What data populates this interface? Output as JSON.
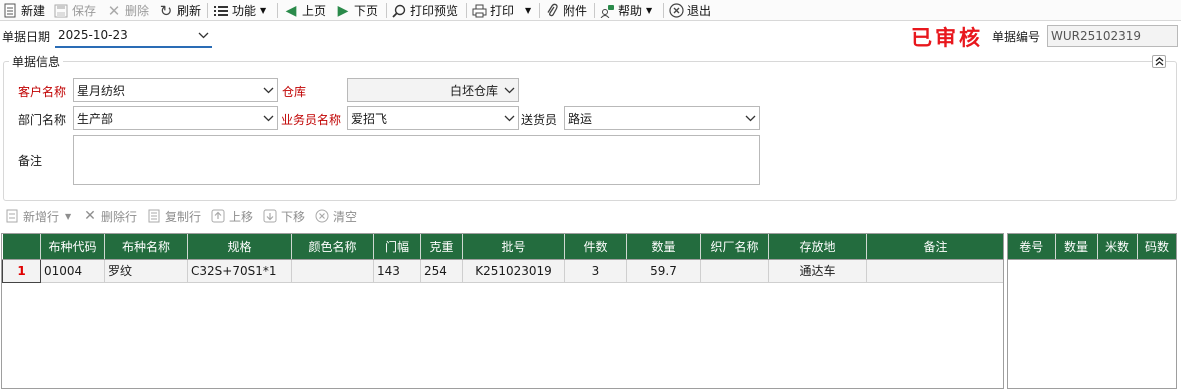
{
  "toolbar": {
    "new": "新建",
    "save": "保存",
    "delete": "删除",
    "refresh": "刷新",
    "function": "功能",
    "prev": "上页",
    "next": "下页",
    "print_preview": "打印预览",
    "print": "打印",
    "attachment": "附件",
    "help": "帮助",
    "exit": "退出"
  },
  "header": {
    "date_label": "单据日期",
    "date_value": "2025-10-23",
    "audit_stamp": "已审核",
    "doc_no_label": "单据编号",
    "doc_no_value": "WUR25102319"
  },
  "section": {
    "title": "单据信息",
    "customer_label": "客户名称",
    "customer_value": "星月纺织",
    "warehouse_label": "仓库",
    "warehouse_value": "白坯仓库",
    "dept_label": "部门名称",
    "dept_value": "生产部",
    "salesman_label": "业务员名称",
    "salesman_value": "爱招飞",
    "deliverer_label": "送货员",
    "deliverer_value": "路运",
    "remark_label": "备注",
    "remark_value": ""
  },
  "detail_toolbar": {
    "add_row": "新增行",
    "delete_row": "删除行",
    "copy_row": "复制行",
    "move_up": "上移",
    "move_down": "下移",
    "clear": "清空"
  },
  "main_grid": {
    "columns": [
      "",
      "布种代码",
      "布种名称",
      "规格",
      "颜色名称",
      "门幅",
      "克重",
      "批号",
      "件数",
      "数量",
      "织厂名称",
      "存放地",
      "备注"
    ],
    "rows": [
      [
        "1",
        "01004",
        "罗纹",
        "C32S+70S1*1",
        "",
        "143",
        "254",
        "K251023019",
        "3",
        "59.7",
        "",
        "通达车",
        ""
      ]
    ]
  },
  "side_grid": {
    "columns": [
      "卷号",
      "数量",
      "米数",
      "码数"
    ]
  },
  "colors": {
    "header_green": "#236c3e",
    "required_red": "#c00000",
    "stamp_red": "#e8171d"
  }
}
